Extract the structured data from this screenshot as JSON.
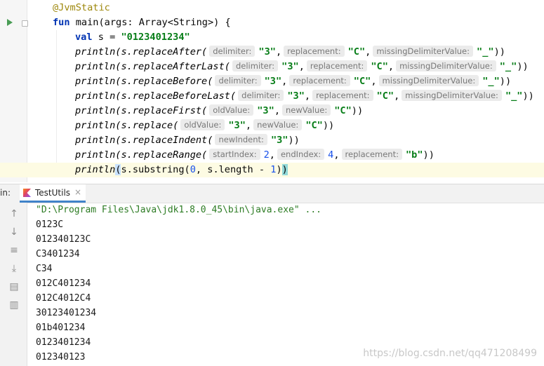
{
  "editor": {
    "annotation": "@JvmStatic",
    "main_signature": {
      "kw": "fun",
      "rest": " main(args: Array<String>) {"
    },
    "val_line": {
      "kw": "val",
      "rest": " s = ",
      "str": "\"0123401234\""
    },
    "calls": [
      {
        "fn": "println",
        "member": "(s.replaceAfter(",
        "args": [
          {
            "hint": "delimiter:",
            "value": "\"3\"",
            "sep": ","
          },
          {
            "hint": "replacement:",
            "value": "\"C\"",
            "sep": ","
          },
          {
            "hint": "missingDelimiterValue:",
            "value": "\"_\"",
            "sep": "))"
          }
        ]
      },
      {
        "fn": "println",
        "member": "(s.replaceAfterLast(",
        "args": [
          {
            "hint": "delimiter:",
            "value": "\"3\"",
            "sep": ","
          },
          {
            "hint": "replacement:",
            "value": "\"C\"",
            "sep": ","
          },
          {
            "hint": "missingDelimiterValue:",
            "value": "\"_\"",
            "sep": "))"
          }
        ]
      },
      {
        "fn": "println",
        "member": "(s.replaceBefore(",
        "args": [
          {
            "hint": "delimiter:",
            "value": "\"3\"",
            "sep": ","
          },
          {
            "hint": "replacement:",
            "value": "\"C\"",
            "sep": ","
          },
          {
            "hint": "missingDelimiterValue:",
            "value": "\"_\"",
            "sep": "))"
          }
        ]
      },
      {
        "fn": "println",
        "member": "(s.replaceBeforeLast(",
        "args": [
          {
            "hint": "delimiter:",
            "value": "\"3\"",
            "sep": ","
          },
          {
            "hint": "replacement:",
            "value": "\"C\"",
            "sep": ","
          },
          {
            "hint": "missingDelimiterValue:",
            "value": "\"_\"",
            "sep": "))"
          }
        ]
      },
      {
        "fn": "println",
        "member": "(s.replaceFirst(",
        "args": [
          {
            "hint": "oldValue:",
            "value": "\"3\"",
            "sep": ","
          },
          {
            "hint": "newValue:",
            "value": "\"C\"",
            "sep": "))"
          }
        ]
      },
      {
        "fn": "println",
        "member": "(s.replace(",
        "args": [
          {
            "hint": "oldValue:",
            "value": "\"3\"",
            "sep": ","
          },
          {
            "hint": "newValue:",
            "value": "\"C\"",
            "sep": "))"
          }
        ]
      },
      {
        "fn": "println",
        "member": "(s.replaceIndent(",
        "args": [
          {
            "hint": "newIndent:",
            "value": "\"3\"",
            "sep": "))"
          }
        ]
      },
      {
        "fn": "println",
        "member": "(s.replaceRange(",
        "args": [
          {
            "hint": "startIndex:",
            "value": "2",
            "sep": ",",
            "num": true
          },
          {
            "hint": "endIndex:",
            "value": "4",
            "sep": ",",
            "num": true
          },
          {
            "hint": "replacement:",
            "value": "\"b\"",
            "sep": "))"
          }
        ]
      }
    ],
    "last_line": {
      "fn": "println",
      "open": "(",
      "body1": "s.substring(",
      "n0": "0",
      "body2": ", s.length - ",
      "n1": "1",
      "close1": ")",
      "close2": ")"
    }
  },
  "run_panel": {
    "prefix": "in:",
    "tab_label": "TestUtils",
    "tab_close": "×",
    "command": "\"D:\\Program Files\\Java\\jdk1.8.0_45\\bin\\java.exe\" ...",
    "output": [
      "0123C",
      "012340123C",
      "C3401234",
      "C34",
      "012C401234",
      "012C4012C4",
      "30123401234",
      "01b401234",
      "0123401234",
      "012340123"
    ],
    "tools": [
      "up-arrow-icon",
      "down-arrow-icon",
      "soft-wrap-icon",
      "scroll-to-end-icon",
      "print-icon",
      "trash-icon"
    ]
  },
  "watermark": "https://blog.csdn.net/qq471208499",
  "colors": {
    "keyword": "#0033b3",
    "string": "#067d17",
    "annotation": "#9e880d",
    "tab_underline": "#4083c9"
  }
}
